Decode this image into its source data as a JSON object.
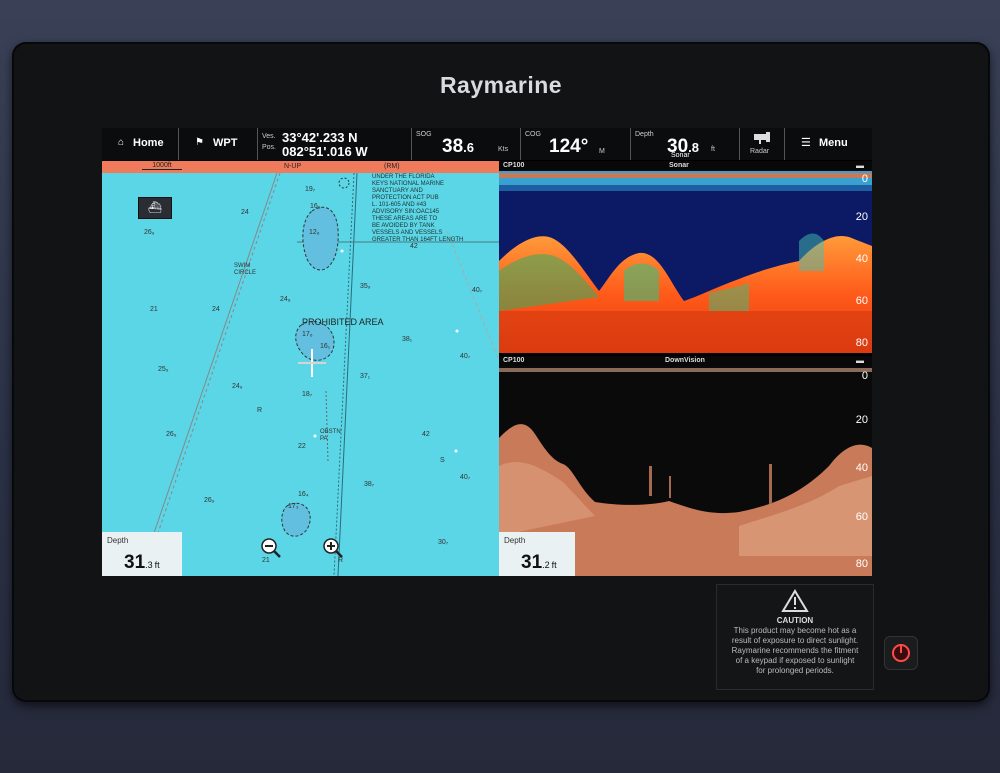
{
  "brand": "Raymarine",
  "topbar": {
    "home_label": "Home",
    "wpt_label": "WPT",
    "ves_label": "Ves.",
    "pos_label": "Pos.",
    "lat": "33°42'.233 N",
    "lon": "082°51'.016 W",
    "sog_label": "SOG",
    "sog_value": "38",
    "sog_decimal": ".6",
    "sog_unit": "Kts",
    "cog_label": "COG",
    "cog_value": "124°",
    "cog_unit": "M",
    "depth_label": "Depth",
    "depth_value": "30",
    "depth_decimal": ".8",
    "depth_unit": "ft",
    "sonar_label": "Sonar",
    "radar_label": "Radar",
    "menu_label": "Menu"
  },
  "chart": {
    "scale_label": "1000ft",
    "orientation": "N-UP",
    "rm_label": "(RM)",
    "notice_lines": [
      "UNDER THE FLORIDA",
      "KEYS NATIONAL MARINE",
      "SANCTUARY AND",
      "PROTECTION ACT PUB",
      "L. 101-605 AND #43",
      "ADVISORY SIN:OAC145",
      "THESE AREAS ARE TO",
      "BE AVOIDED BY TANK",
      "VESSELS AND VESSELS",
      "GREATER THAN 164FT LENGTH"
    ],
    "area_label": "PROHIBITED AREA",
    "swim_label": "SWIM",
    "circle_label": "CIRCLE",
    "obstn_label": "OBSTN",
    "pa_label": "PA",
    "soundings": [
      {
        "t": "19₇"
      },
      {
        "t": "16₃"
      },
      {
        "t": "24"
      },
      {
        "t": "26₉"
      },
      {
        "t": "12₆"
      },
      {
        "t": "42"
      },
      {
        "t": "35₉"
      },
      {
        "t": "40₇"
      },
      {
        "t": "21"
      },
      {
        "t": "24"
      },
      {
        "t": "24₈"
      },
      {
        "t": "17₆"
      },
      {
        "t": "16₁"
      },
      {
        "t": "38₁"
      },
      {
        "t": "40₇"
      },
      {
        "t": "25₉"
      },
      {
        "t": "24₉"
      },
      {
        "t": "37₁"
      },
      {
        "t": "18₇"
      },
      {
        "t": "R"
      },
      {
        "t": "26₉"
      },
      {
        "t": "22"
      },
      {
        "t": "42"
      },
      {
        "t": "38₇"
      },
      {
        "t": "40₇"
      },
      {
        "t": "26₉"
      },
      {
        "t": "16₄"
      },
      {
        "t": "17₃"
      },
      {
        "t": "21"
      },
      {
        "t": "30₇"
      },
      {
        "t": "S"
      },
      {
        "t": "R"
      }
    ],
    "depth_label": "Depth",
    "depth_value": "31",
    "depth_decimal": ".3",
    "depth_unit": "ft"
  },
  "sonar": {
    "source": "CP100",
    "title": "Sonar",
    "scale": [
      "0",
      "20",
      "40",
      "60",
      "80"
    ]
  },
  "downvision": {
    "source": "CP100",
    "title": "DownVision",
    "scale": [
      "0",
      "20",
      "40",
      "60",
      "80"
    ],
    "depth_label": "Depth",
    "depth_value": "31",
    "depth_decimal": ".2",
    "depth_unit": "ft"
  },
  "caution": {
    "title": "CAUTION",
    "lines": [
      "This product may become hot as a",
      "result of exposure to direct sunlight.",
      "Raymarine recommends the fitment",
      "of a keypad if exposed to sunlight",
      "for prolonged periods."
    ]
  },
  "colors": {
    "chart_water": "#5ad6e6",
    "chart_header": "#f07a5c",
    "sonar_bg": "#0c1a66"
  }
}
